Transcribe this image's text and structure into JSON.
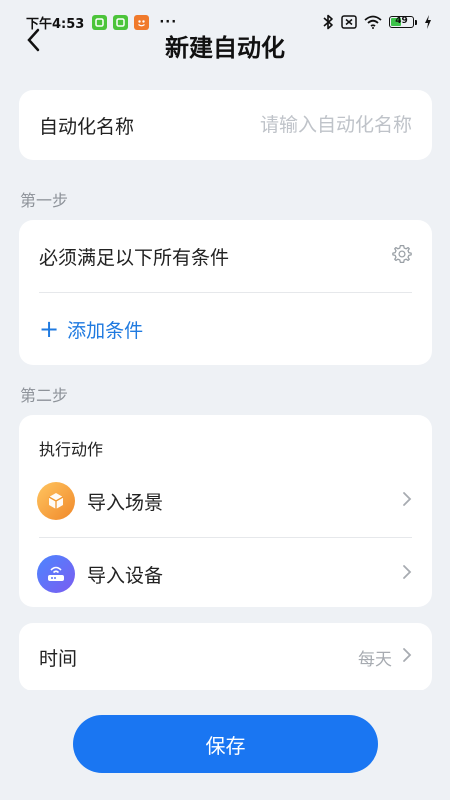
{
  "status_bar": {
    "time": "下午4:53",
    "more": "···",
    "battery_level": "49",
    "notification_colors": [
      "#4cc43a",
      "#4cc43a",
      "#f07a2c"
    ]
  },
  "nav": {
    "title": "新建自动化"
  },
  "name_field": {
    "label": "自动化名称",
    "placeholder": "请输入自动化名称",
    "value": ""
  },
  "step1": {
    "label": "第一步",
    "condition_text": "必须满足以下所有条件",
    "add_label": "添加条件"
  },
  "step2": {
    "label": "第二步",
    "header": "执行动作",
    "items": [
      {
        "label": "导入场景",
        "icon": "cube-icon"
      },
      {
        "label": "导入设备",
        "icon": "router-icon"
      }
    ]
  },
  "time": {
    "label": "时间",
    "value": "每天"
  },
  "save_label": "保存",
  "colors": {
    "accent": "#1a76f2",
    "link": "#1f7ae0",
    "background": "#eef1f5"
  }
}
